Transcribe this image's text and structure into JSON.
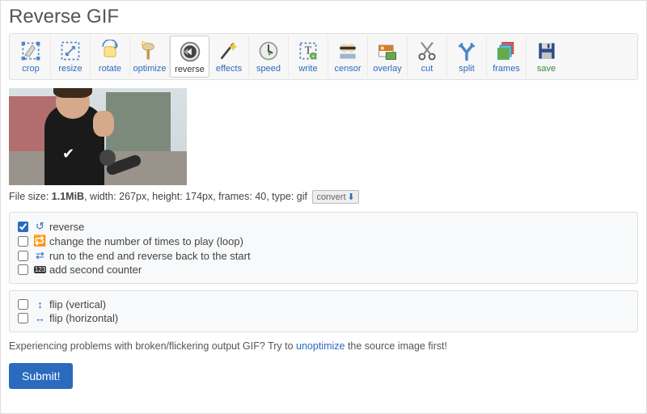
{
  "title": "Reverse GIF",
  "tools": [
    {
      "label": "crop"
    },
    {
      "label": "resize"
    },
    {
      "label": "rotate"
    },
    {
      "label": "optimize"
    },
    {
      "label": "reverse"
    },
    {
      "label": "effects"
    },
    {
      "label": "speed"
    },
    {
      "label": "write"
    },
    {
      "label": "censor"
    },
    {
      "label": "overlay"
    },
    {
      "label": "cut"
    },
    {
      "label": "split"
    },
    {
      "label": "frames"
    },
    {
      "label": "save"
    }
  ],
  "file": {
    "prefix": "File size: ",
    "size": "1.1MiB",
    "rest": ", width: 267px, height: 174px, frames: 40, type: gif",
    "convert": "convert"
  },
  "options": {
    "reverse": "reverse",
    "loop": "change the number of times to play (loop)",
    "run_end": "run to the end and reverse back to the start",
    "counter": "add second counter",
    "flip_v": "flip (vertical)",
    "flip_h": "flip (horizontal)"
  },
  "note": {
    "before": "Experiencing problems with broken/flickering output GIF? Try to ",
    "link": "unoptimize",
    "after": " the source image first!"
  },
  "submit": "Submit!"
}
